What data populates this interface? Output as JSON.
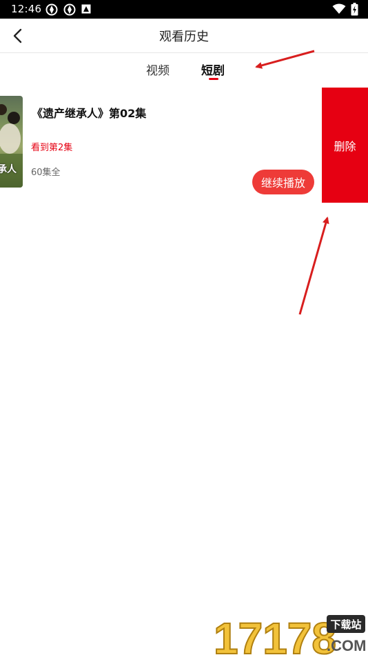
{
  "status_bar": {
    "time": "12:46",
    "left_icons": [
      "sync-icon",
      "sync-icon",
      "app-notification-icon"
    ],
    "right_icons": [
      "wifi-icon",
      "battery-icon"
    ]
  },
  "header": {
    "back_icon": "chevron-left-icon",
    "title": "观看历史"
  },
  "tabs": [
    {
      "label": "视频",
      "active": false
    },
    {
      "label": "短剧",
      "active": true
    }
  ],
  "history": [
    {
      "poster_text": "承人",
      "title": "《遗产继承人》第02集",
      "progress": "看到第2集",
      "episodes": "60集全",
      "continue_label": "继续播放",
      "delete_label": "删除"
    }
  ],
  "colors": {
    "accent": "#e60012",
    "continue_button": "#ee3b38",
    "annotation_arrow": "#d81e1e"
  },
  "watermark": {
    "number": "17178",
    "tag": "下载站",
    "domain": ".COM"
  }
}
